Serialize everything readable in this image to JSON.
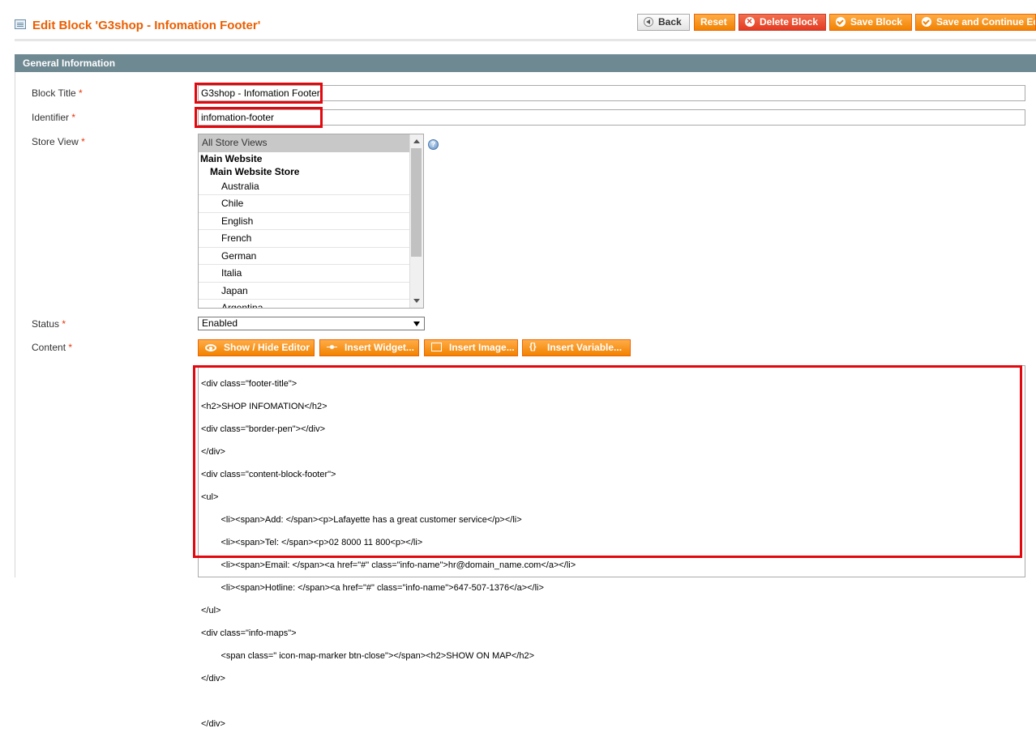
{
  "header": {
    "title": "Edit Block 'G3shop - Infomation Footer'",
    "buttons": {
      "back": "Back",
      "reset": "Reset",
      "delete": "Delete Block",
      "save": "Save Block",
      "save_continue": "Save and Continue Edit"
    }
  },
  "section": {
    "title": "General Information"
  },
  "form": {
    "block_title": {
      "label": "Block Title",
      "required": "*",
      "value": "G3shop - Infomation Footer"
    },
    "identifier": {
      "label": "Identifier",
      "required": "*",
      "value": "infomation-footer"
    },
    "store_view": {
      "label": "Store View",
      "required": "*",
      "selected": "All Store Views",
      "group": "Main Website",
      "subgroup": "Main Website Store",
      "options": [
        "Australia",
        "Chile",
        "English",
        "French",
        "German",
        "Italia",
        "Japan",
        "Argentina"
      ]
    },
    "status": {
      "label": "Status",
      "required": "*",
      "value": "Enabled"
    },
    "content": {
      "label": "Content",
      "required": "*",
      "buttons": {
        "toggle_editor": "Show / Hide Editor",
        "insert_widget": "Insert Widget...",
        "insert_image": "Insert Image...",
        "insert_variable": "Insert Variable..."
      },
      "lines": [
        "<div class=\"footer-title\">",
        "<h2>SHOP INFOMATION</h2>",
        "<div class=\"border-pen\"></div>",
        "</div>",
        "<div class=\"content-block-footer\">",
        "<ul>",
        "        <li><span>Add: </span><p>Lafayette has a great customer service</p></li>",
        "        <li><span>Tel: </span><p>02 8000 11 800<p></li>",
        "        <li><span>Email: </span><a href=\"#\" class=\"info-name\">hr@domain_name.com</a></li>",
        "        <li><span>Hotline: </span><a href=\"#\" class=\"info-name\">647-507-1376</a></li>",
        "</ul>",
        "<div class=\"info-maps\">",
        "        <span class=\" icon-map-marker btn-close\"></span><h2>SHOW ON MAP</h2>",
        "</div>",
        "",
        "</div>"
      ]
    }
  },
  "colors": {
    "accent": "#eb5e00",
    "button": "#f18200",
    "highlight": "#e2080e",
    "section_bar": "#6f8992"
  }
}
